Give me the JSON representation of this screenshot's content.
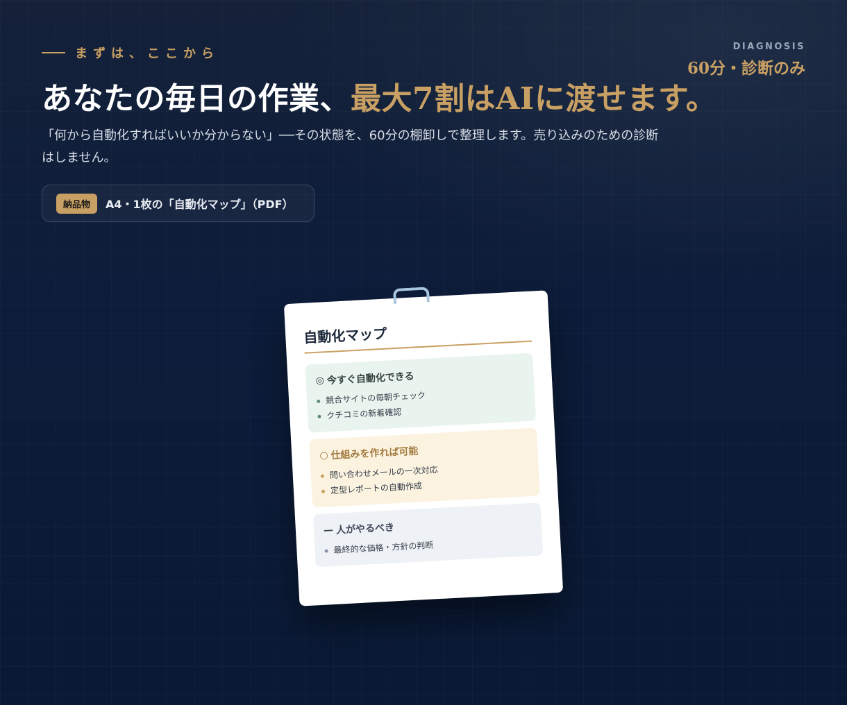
{
  "hero": {
    "eyebrow": "まずは、ここから",
    "corner_en": "DIAGNOSIS",
    "corner_ja": "60分・診断のみ",
    "headline_main": "あなたの毎日の作業、",
    "headline_accent": "最大7割はAIに渡せます。",
    "lead": "「何から自動化すればいいか分からない」──その状態を、60分の棚卸しで整理します。売り込みのための診断はしません。",
    "deliverable_tag": "納品物",
    "deliverable_text": "A4・1枚の「自動化マップ」（PDF）"
  },
  "card": {
    "title": "自動化マップ",
    "sections": [
      {
        "marker": "◎",
        "heading": "今すぐ自動化できる",
        "items": [
          "競合サイトの毎朝チェック",
          "クチコミの新着確認"
        ]
      },
      {
        "marker": "○",
        "heading": "仕組みを作れば可能",
        "items": [
          "問い合わせメールの一次対応",
          "定型レポートの自動作成"
        ]
      },
      {
        "marker": "—",
        "heading": "人がやるべき",
        "items": [
          "最終的な価格・方針の判断"
        ]
      }
    ]
  },
  "colors": {
    "accent": "#c9a063",
    "background": "#0c1c3a"
  }
}
